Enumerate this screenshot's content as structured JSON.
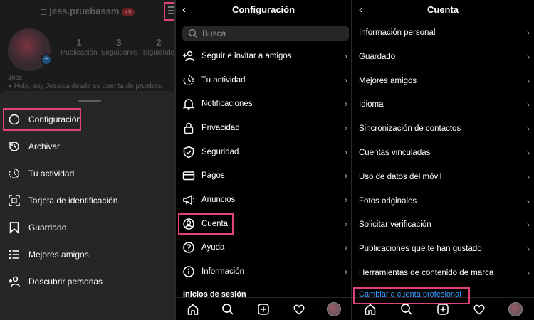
{
  "panel_profile": {
    "username": "jess.pruebassm",
    "notification_badge": "+9",
    "stats": [
      {
        "value": "1",
        "label": "Publicación"
      },
      {
        "value": "3",
        "label": "Seguidores"
      },
      {
        "value": "2",
        "label": "Siguiendo"
      }
    ],
    "bio_name": "Jess",
    "bio_text": "Hola, soy Jessica desde su cuenta de pruebas.",
    "sheet_items": [
      {
        "label": "Configuración",
        "icon": "settings-icon"
      },
      {
        "label": "Archivar",
        "icon": "archive-icon"
      },
      {
        "label": "Tu actividad",
        "icon": "activity-icon"
      },
      {
        "label": "Tarjeta de identificación",
        "icon": "qr-code-icon"
      },
      {
        "label": "Guardado",
        "icon": "bookmark-icon"
      },
      {
        "label": "Mejores amigos",
        "icon": "close-friends-icon"
      },
      {
        "label": "Descubrir personas",
        "icon": "add-person-icon"
      }
    ]
  },
  "panel_settings": {
    "title": "Configuración",
    "search_placeholder": "Busca",
    "items": [
      {
        "label": "Seguir e invitar a amigos",
        "icon": "add-person-icon"
      },
      {
        "label": "Tu actividad",
        "icon": "activity-icon"
      },
      {
        "label": "Notificaciones",
        "icon": "bell-icon"
      },
      {
        "label": "Privacidad",
        "icon": "lock-icon"
      },
      {
        "label": "Seguridad",
        "icon": "shield-icon"
      },
      {
        "label": "Pagos",
        "icon": "card-icon"
      },
      {
        "label": "Anuncios",
        "icon": "megaphone-icon"
      },
      {
        "label": "Cuenta",
        "icon": "account-icon"
      },
      {
        "label": "Ayuda",
        "icon": "help-icon"
      },
      {
        "label": "Información",
        "icon": "info-icon"
      }
    ],
    "section_heading": "Inicios de sesión"
  },
  "panel_account": {
    "title": "Cuenta",
    "items": [
      "Información personal",
      "Guardado",
      "Mejores amigos",
      "Idioma",
      "Sincronización de contactos",
      "Cuentas vinculadas",
      "Uso de datos del móvil",
      "Fotos originales",
      "Solicitar verificación",
      "Publicaciones que te han gustado",
      "Herramientas de contenido de marca"
    ],
    "switch_link": "Cambiar a cuenta profesional"
  },
  "tabbar": [
    "home-icon",
    "search-icon",
    "new-post-icon",
    "heart-icon",
    "profile-avatar"
  ],
  "colors": {
    "highlight": "#e0427c",
    "link": "#3c9bff",
    "background": "#000000",
    "sheet": "#262626"
  }
}
